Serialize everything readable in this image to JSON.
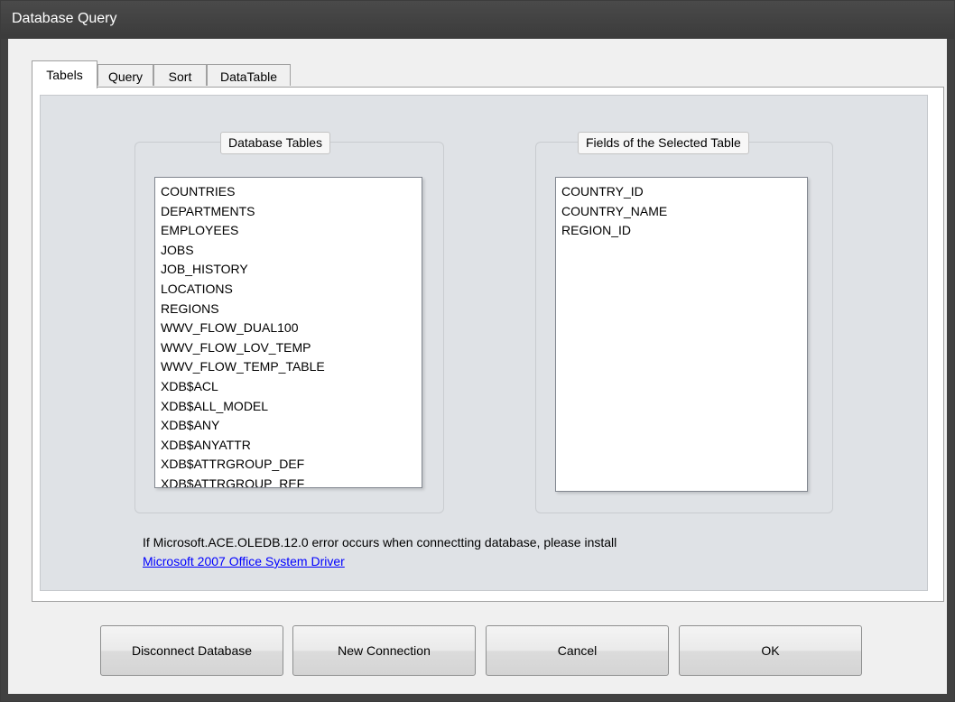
{
  "window": {
    "title": "Database Query"
  },
  "tabs": [
    {
      "label": "Tabels",
      "active": true
    },
    {
      "label": "Query",
      "active": false
    },
    {
      "label": "Sort",
      "active": false
    },
    {
      "label": "DataTable",
      "active": false
    }
  ],
  "tables_group": {
    "label": "Database Tables",
    "items": [
      "COUNTRIES",
      "DEPARTMENTS",
      "EMPLOYEES",
      "JOBS",
      "JOB_HISTORY",
      "LOCATIONS",
      "REGIONS",
      "WWV_FLOW_DUAL100",
      "WWV_FLOW_LOV_TEMP",
      "WWV_FLOW_TEMP_TABLE",
      "XDB$ACL",
      "XDB$ALL_MODEL",
      "XDB$ANY",
      "XDB$ANYATTR",
      "XDB$ATTRGROUP_DEF",
      "XDB$ATTRGROUP_REF"
    ]
  },
  "fields_group": {
    "label": "Fields of the Selected Table",
    "items": [
      "COUNTRY_ID",
      "COUNTRY_NAME",
      "REGION_ID"
    ]
  },
  "note": {
    "text": "If Microsoft.ACE.OLEDB.12.0 error occurs when connectting database,  please install",
    "link": "Microsoft 2007 Office System Driver"
  },
  "buttons": {
    "disconnect": "Disconnect Database",
    "new_connection": "New Connection",
    "cancel": "Cancel",
    "ok": "OK"
  }
}
